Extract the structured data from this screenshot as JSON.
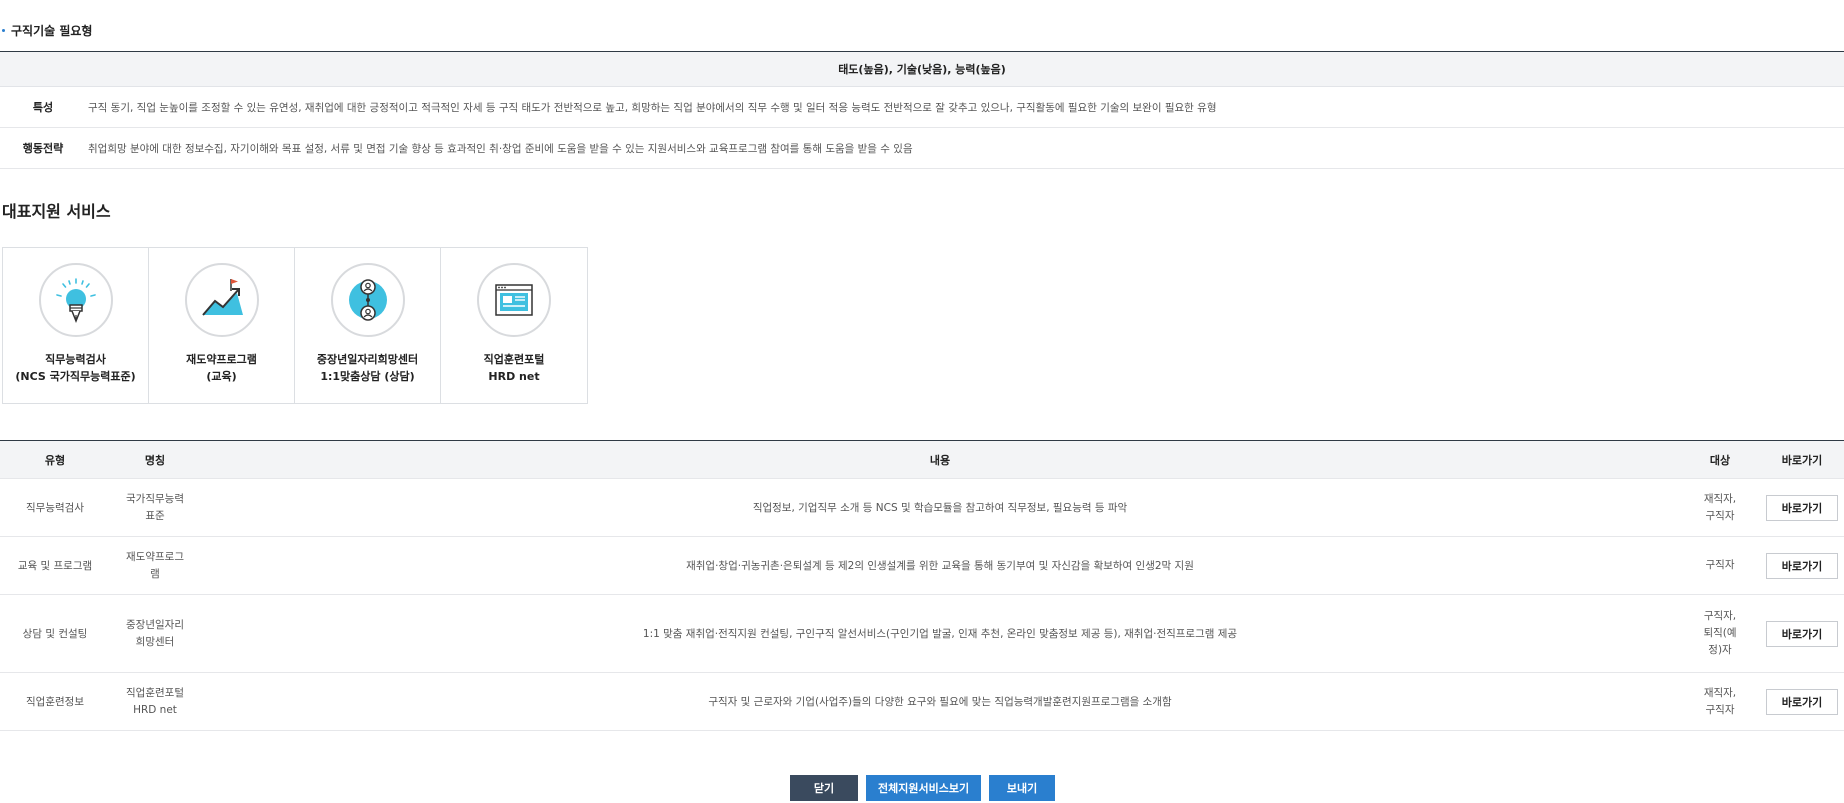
{
  "section_title": "구직기술 필요형",
  "type_table": {
    "header": "태도(높음), 기술(낮음), 능력(높음)",
    "rows": [
      {
        "label": "특성",
        "text": "구직 동기, 직업 눈높이를 조정할 수 있는 유연성, 재취업에 대한 긍정적이고 적극적인 자세 등 구직 태도가 전반적으로 높고, 희망하는 직업 분야에서의 직무 수행 및 일터 적응 능력도 전반적으로 잘 갖추고 있으나, 구직활동에 필요한 기술의 보완이 필요한 유형"
      },
      {
        "label": "행동전략",
        "text": "취업희망 분야에 대한 정보수집, 자기이해와 목표 설정, 서류 및 면접 기술 향상 등 효과적인 취·창업 준비에 도움을 받을 수 있는 지원서비스와 교육프로그램 참여를 통해 도움을 받을 수 있음"
      }
    ]
  },
  "services_title": "대표지원 서비스",
  "cards": [
    {
      "line1": "직무능력검사",
      "line2": "(NCS 국가직무능력표준)",
      "icon": "lightbulb-icon"
    },
    {
      "line1": "재도약프로그램",
      "line2": "(교육)",
      "icon": "growth-chart-icon"
    },
    {
      "line1": "중장년일자리희망센터",
      "line2": "1:1맞춤상담 (상담)",
      "icon": "consulting-people-icon"
    },
    {
      "line1": "직업훈련포털",
      "line2": "HRD net",
      "icon": "web-portal-icon"
    }
  ],
  "service_table": {
    "headers": {
      "type": "유형",
      "name": "명칭",
      "content": "내용",
      "target": "대상",
      "go": "바로가기"
    },
    "rows": [
      {
        "type": "직무능력검사",
        "name1": "국가직무능력",
        "name2": "표준",
        "content": "직업정보, 기업직무 소개 등 NCS 및 학습모듈을 참고하여 직무정보, 필요능력 등 파악",
        "target1": "재직자,",
        "target2": "구직자",
        "target3": "",
        "go": "바로가기"
      },
      {
        "type": "교육 및 프로그램",
        "name1": "재도약프로그",
        "name2": "램",
        "content": "재취업·창업·귀농귀촌·은퇴설계 등 제2의 인생설계를 위한 교육을 통해 동기부여 및 자신감을 확보하여 인생2막 지원",
        "target1": "구직자",
        "target2": "",
        "target3": "",
        "go": "바로가기"
      },
      {
        "type": "상담 및 컨설팅",
        "name1": "중장년일자리",
        "name2": "희망센터",
        "content": "1:1 맞춤 재취업·전직지원 컨설팅, 구인구직 알선서비스(구인기업 발굴, 인재 추천, 온라인 맞춤정보 제공 등), 재취업·전직프로그램 제공",
        "target1": "구직자,",
        "target2": "퇴직(예",
        "target3": "정)자",
        "go": "바로가기"
      },
      {
        "type": "직업훈련정보",
        "name1": "직업훈련포털",
        "name2": "HRD net",
        "content": "구직자 및 근로자와 기업(사업주)들의 다양한 요구와 필요에 맞는 직업능력개발훈련지원프로그램을 소개함",
        "target1": "재직자,",
        "target2": "구직자",
        "target3": "",
        "go": "바로가기"
      }
    ]
  },
  "buttons": {
    "close": "닫기",
    "view_all": "전체지원서비스보기",
    "send": "보내기"
  },
  "colors": {
    "accent": "#2a7fcf",
    "dark_button": "#3a4a5e",
    "icon_cyan": "#3fc0e0",
    "icon_red": "#e0563a"
  }
}
